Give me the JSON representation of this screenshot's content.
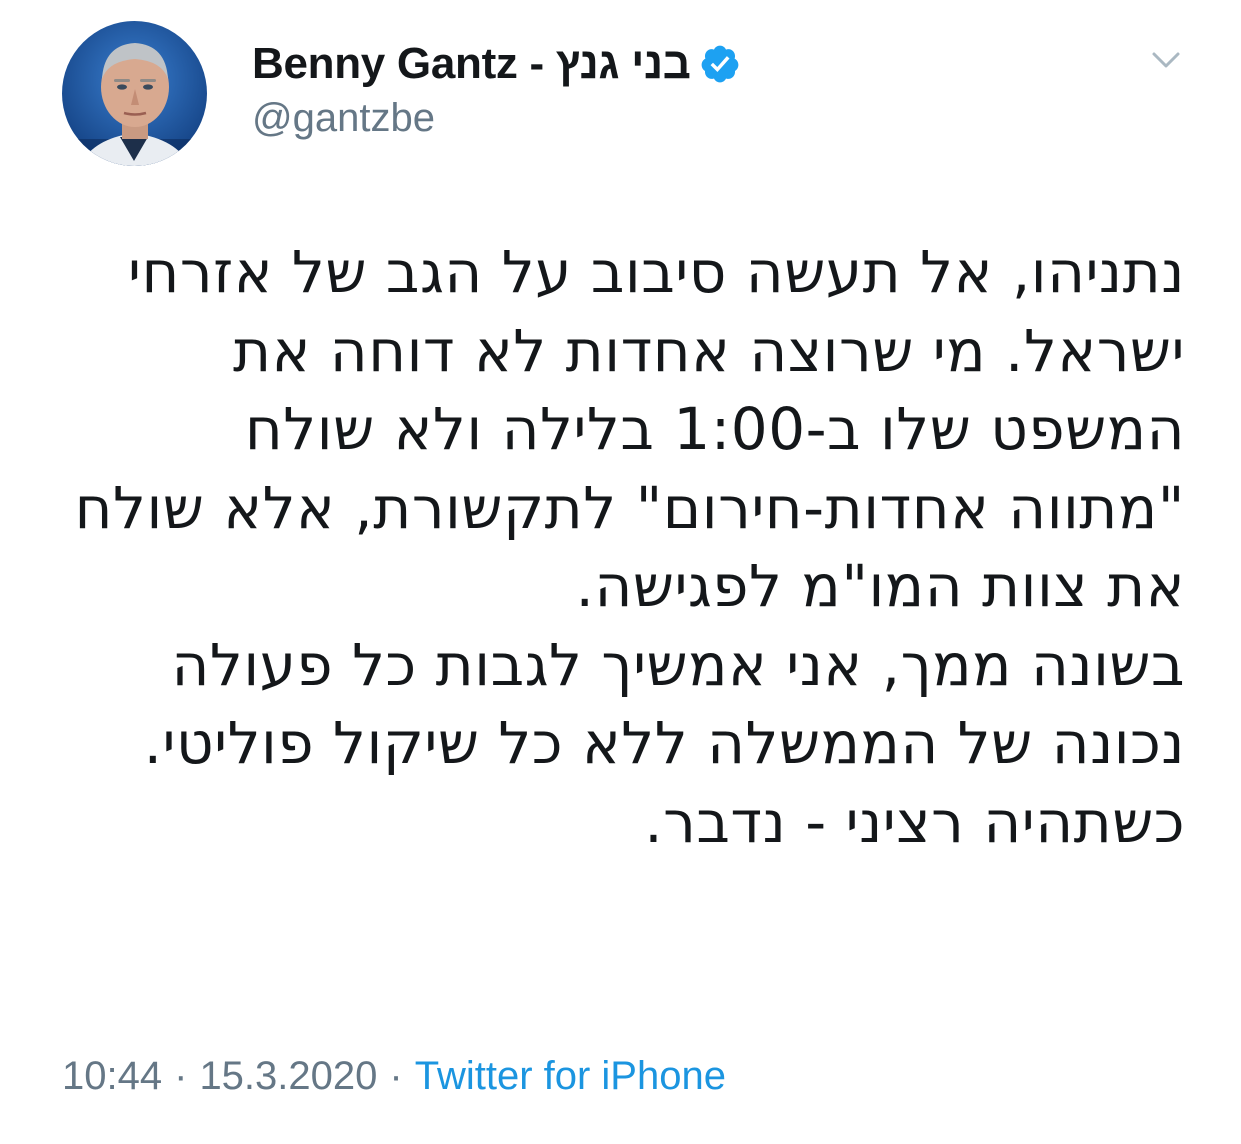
{
  "author": {
    "display_name": "Benny Gantz - בני גנץ",
    "handle": "@gantzbe",
    "verified": true
  },
  "tweet": {
    "lines": [
      "נתניהו, אל תעשה סיבוב על הגב של אזרחי",
      "ישראל. מי שרוצה אחדות לא דוחה את",
      "המשפט שלו ב-1:00 בלילה ולא שולח",
      "\"מתווה אחדות-חירום\" לתקשורת, אלא שולח",
      "את צוות המו\"מ לפגישה.",
      "בשונה ממך, אני אמשיך לגבות כל פעולה",
      "נכונה של הממשלה ללא כל שיקול פוליטי.",
      "כשתהיה רציני - נדבר."
    ]
  },
  "meta": {
    "time": "10:44",
    "separator": "·",
    "date": "15.3.2020",
    "source": "Twitter for iPhone"
  },
  "icons": {
    "verified": "verified-badge-icon",
    "menu": "chevron-down-icon"
  },
  "colors": {
    "text": "#14171a",
    "secondary": "#657786",
    "link": "#1b95e0",
    "verified": "#1da1f2"
  }
}
